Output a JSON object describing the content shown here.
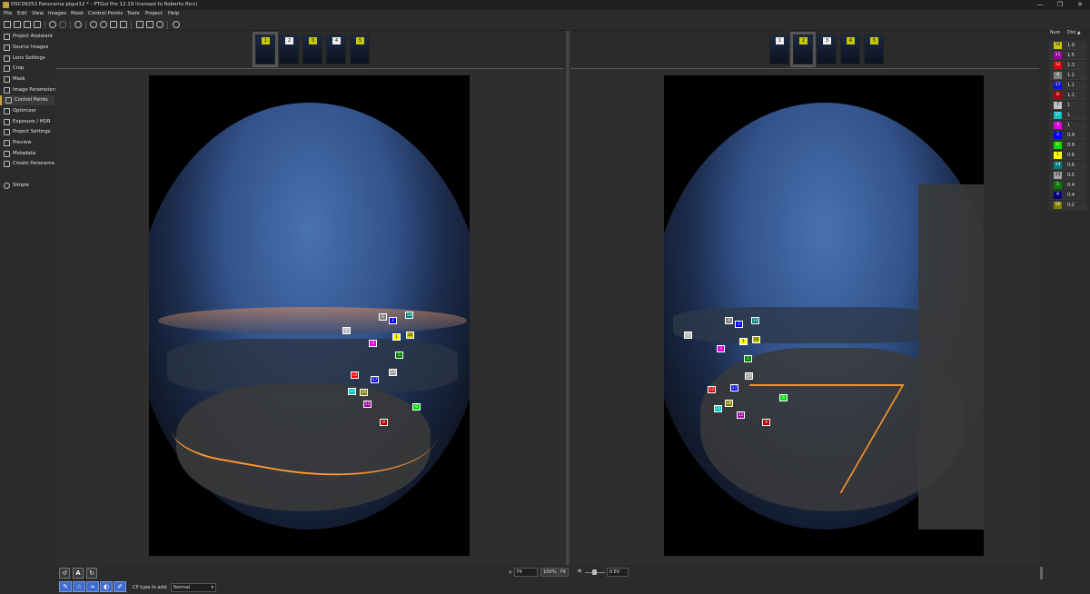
{
  "window": {
    "title": "DSC09252 Panorama ptgui12 * - PTGui Pro 12.19 licensed to Roberto Ricci",
    "minimize": "—",
    "maximize": "❐",
    "close": "✕"
  },
  "menu": [
    "File",
    "Edit",
    "View",
    "Images",
    "Mask",
    "Control Points",
    "Tools",
    "Project",
    "Help"
  ],
  "sidebar": [
    {
      "label": "Project Assistant",
      "icon": "home-icon"
    },
    {
      "label": "Source Images",
      "icon": "images-icon"
    },
    {
      "label": "Lens Settings",
      "icon": "lens-icon"
    },
    {
      "label": "Crop",
      "icon": "crop-icon"
    },
    {
      "label": "Mask",
      "icon": "mask-icon"
    },
    {
      "label": "Image Parameters",
      "icon": "image-params-icon"
    },
    {
      "label": "Control Points",
      "icon": "control-points-icon",
      "active": true
    },
    {
      "label": "Optimizer",
      "icon": "optimizer-icon"
    },
    {
      "label": "Exposure / HDR",
      "icon": "exposure-icon"
    },
    {
      "label": "Project Settings",
      "icon": "settings-icon"
    },
    {
      "label": "Preview",
      "icon": "eye-icon"
    },
    {
      "label": "Metadata",
      "icon": "info-icon"
    },
    {
      "label": "Create Panorama",
      "icon": "panorama-icon"
    },
    {
      "label": "Simple",
      "icon": "simple-icon"
    }
  ],
  "left_thumbs": [
    "1",
    "2",
    "3",
    "4",
    "5"
  ],
  "right_thumbs": [
    "1",
    "2",
    "3",
    "4",
    "5"
  ],
  "left_selected": 0,
  "right_selected": 1,
  "cp_table": {
    "headers": [
      "Num",
      "Dist ▲"
    ],
    "rows": [
      {
        "num": "10",
        "dist": "1.9",
        "color": "#c8c800"
      },
      {
        "num": "11",
        "dist": "1.5",
        "color": "#a000a0"
      },
      {
        "num": "12",
        "dist": "1.3",
        "color": "#e00000"
      },
      {
        "num": "4",
        "dist": "1.2",
        "color": "#808080"
      },
      {
        "num": "17",
        "dist": "1.1",
        "color": "#1010e0"
      },
      {
        "num": "8",
        "dist": "1.1",
        "color": "#b00000"
      },
      {
        "num": "7",
        "dist": "1",
        "color": "#c0c0c0"
      },
      {
        "num": "15",
        "dist": "1",
        "color": "#00c0c0"
      },
      {
        "num": "3",
        "dist": "1",
        "color": "#e000e0"
      },
      {
        "num": "2",
        "dist": "0.9",
        "color": "#0000ff"
      },
      {
        "num": "6",
        "dist": "0.8",
        "color": "#00e000"
      },
      {
        "num": "1",
        "dist": "0.6",
        "color": "#ffff00"
      },
      {
        "num": "14",
        "dist": "0.6",
        "color": "#008080"
      },
      {
        "num": "13",
        "dist": "0.5",
        "color": "#a0a0a0"
      },
      {
        "num": "5",
        "dist": "0.4",
        "color": "#008000"
      },
      {
        "num": "9",
        "dist": "0.4",
        "color": "#000080"
      },
      {
        "num": "16",
        "dist": "0.2",
        "color": "#808000"
      }
    ]
  },
  "left_points": [
    {
      "n": "4",
      "c": "#808080"
    },
    {
      "n": "2",
      "c": "#0000ff"
    },
    {
      "n": "14",
      "c": "#008080"
    },
    {
      "n": "7",
      "c": "#c0c0c0"
    },
    {
      "n": "1",
      "c": "#ffff00"
    },
    {
      "n": "10",
      "c": "#c8c800"
    },
    {
      "n": "3",
      "c": "#e000e0"
    },
    {
      "n": "5",
      "c": "#008000"
    },
    {
      "n": "13",
      "c": "#a0a0a0"
    },
    {
      "n": "12",
      "c": "#e00000"
    },
    {
      "n": "17",
      "c": "#1010e0"
    },
    {
      "n": "15",
      "c": "#00c0c0"
    },
    {
      "n": "16",
      "c": "#808000"
    },
    {
      "n": "11",
      "c": "#a000a0"
    },
    {
      "n": "6",
      "c": "#00e000"
    },
    {
      "n": "8",
      "c": "#b00000"
    }
  ],
  "right_points": [
    {
      "n": "4",
      "c": "#808080"
    },
    {
      "n": "2",
      "c": "#0000ff"
    },
    {
      "n": "14",
      "c": "#008080"
    },
    {
      "n": "7",
      "c": "#c0c0c0"
    },
    {
      "n": "1",
      "c": "#ffff00"
    },
    {
      "n": "10",
      "c": "#c8c800"
    },
    {
      "n": "3",
      "c": "#e000e0"
    },
    {
      "n": "5",
      "c": "#008000"
    },
    {
      "n": "13",
      "c": "#a0a0a0"
    },
    {
      "n": "12",
      "c": "#e00000"
    },
    {
      "n": "17",
      "c": "#1010e0"
    },
    {
      "n": "15",
      "c": "#00c0c0"
    },
    {
      "n": "16",
      "c": "#808000"
    },
    {
      "n": "11",
      "c": "#a000a0"
    },
    {
      "n": "6",
      "c": "#00e000"
    },
    {
      "n": "8",
      "c": "#b00000"
    }
  ],
  "bottom": {
    "zoom_fit": "Fit",
    "zoom_100": "100%",
    "zoom_fit2": "Fit",
    "ev": "0 EV",
    "cp_type_label": "CP type to add:",
    "cp_type_value": "Normal"
  }
}
